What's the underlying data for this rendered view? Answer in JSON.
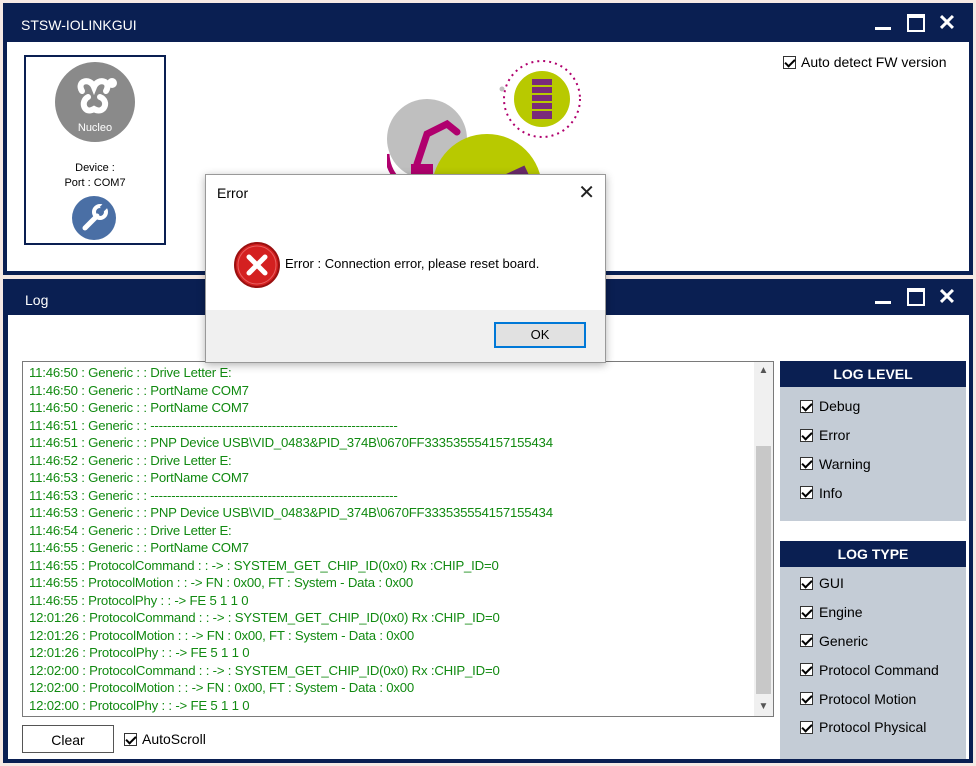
{
  "main_window": {
    "title": "STSW-IOLINKGUI",
    "auto_detect_label": "Auto detect FW version",
    "auto_detect_checked": true
  },
  "device": {
    "logo_text": "Nucleo",
    "device_label": "Device :",
    "port_label": "Port : COM7"
  },
  "log_window": {
    "title": "Log",
    "lines": [
      "11:46:50 : Generic :  : Drive Letter E:",
      "11:46:50 : Generic :  : PortName COM7",
      "11:46:50 : Generic :  : PortName COM7",
      "11:46:51 : Generic :  : -----------------------------------------------------------",
      "11:46:51 : Generic :  : PNP Device USB\\VID_0483&PID_374B\\0670FF333535554157155434",
      "11:46:52 : Generic :  : Drive Letter E:",
      "11:46:53 : Generic :  : PortName COM7",
      "11:46:53 : Generic :  : -----------------------------------------------------------",
      "11:46:53 : Generic :  : PNP Device USB\\VID_0483&PID_374B\\0670FF333535554157155434",
      "11:46:54 : Generic :  : Drive Letter E:",
      "11:46:55 : Generic :  : PortName COM7",
      "11:46:55 : ProtocolCommand :  : -> : SYSTEM_GET_CHIP_ID(0x0)  Rx :CHIP_ID=0",
      "11:46:55 : ProtocolMotion :  : -> FN : 0x00, FT : System - Data : 0x00",
      "11:46:55 : ProtocolPhy :  :  -> FE 5 1 1 0",
      "12:01:26 : ProtocolCommand :  : -> : SYSTEM_GET_CHIP_ID(0x0)  Rx :CHIP_ID=0",
      "12:01:26 : ProtocolMotion :  : -> FN : 0x00, FT : System - Data : 0x00",
      "12:01:26 : ProtocolPhy :  :  -> FE 5 1 1 0",
      "12:02:00 : ProtocolCommand :  : -> : SYSTEM_GET_CHIP_ID(0x0)  Rx :CHIP_ID=0",
      "12:02:00 : ProtocolMotion :  : -> FN : 0x00, FT : System - Data : 0x00",
      "12:02:00 : ProtocolPhy :  :  -> FE 5 1 1 0"
    ],
    "clear_label": "Clear",
    "autoscroll_label": "AutoScroll",
    "autoscroll_checked": true
  },
  "log_level": {
    "title": "LOG LEVEL",
    "items": [
      {
        "label": "Debug",
        "checked": true
      },
      {
        "label": "Error",
        "checked": true
      },
      {
        "label": "Warning",
        "checked": true
      },
      {
        "label": "Info",
        "checked": true
      }
    ]
  },
  "log_type": {
    "title": "LOG TYPE",
    "items": [
      {
        "label": "GUI",
        "checked": true
      },
      {
        "label": "Engine",
        "checked": true
      },
      {
        "label": "Generic",
        "checked": true
      },
      {
        "label": "Protocol Command",
        "checked": true
      },
      {
        "label": "Protocol Motion",
        "checked": true
      },
      {
        "label": "Protocol Physical",
        "checked": true
      }
    ]
  },
  "error_dialog": {
    "title": "Error",
    "message": "Error : Connection error, please reset board.",
    "ok_label": "OK"
  },
  "colors": {
    "titlebar": "#0a1f52",
    "log_text": "#118a11",
    "panel_bg": "#c4ccd6",
    "accent_lime": "#b8c900",
    "accent_magenta": "#b0006e",
    "error_red": "#d42020"
  },
  "icons": {
    "minimize": "minimize-icon",
    "maximize": "maximize-icon",
    "close": "close-icon",
    "settings": "wrench-icon",
    "error": "error-icon"
  }
}
